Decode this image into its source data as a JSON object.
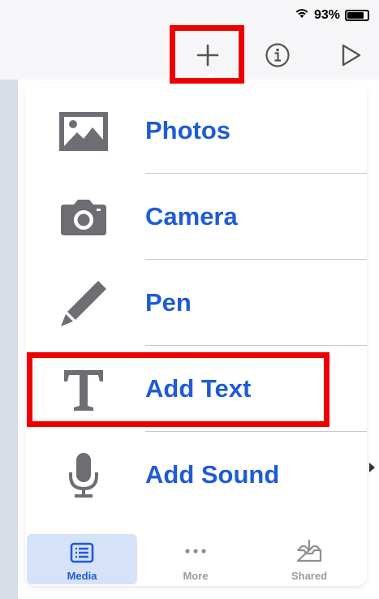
{
  "status_bar": {
    "battery_text": "93%",
    "battery_level": 0.93
  },
  "toolbar": {
    "add_icon": "plus-icon",
    "info_icon": "info-icon",
    "play_icon": "play-icon"
  },
  "menu": {
    "items": [
      {
        "label": "Photos",
        "icon": "photos-icon"
      },
      {
        "label": "Camera",
        "icon": "camera-icon"
      },
      {
        "label": "Pen",
        "icon": "pen-icon"
      },
      {
        "label": "Add Text",
        "icon": "text-icon"
      },
      {
        "label": "Add Sound",
        "icon": "microphone-icon"
      }
    ]
  },
  "tabs": [
    {
      "label": "Media",
      "icon": "media-icon",
      "selected": true
    },
    {
      "label": "More",
      "icon": "ellipsis-icon",
      "selected": false
    },
    {
      "label": "Shared",
      "icon": "inbox-icon",
      "selected": false
    }
  ],
  "colors": {
    "accent": "#1f5bd6",
    "highlight": "#ee0000",
    "icon_gray": "#6d6e73",
    "tab_selected_bg": "#d6e2f7"
  }
}
